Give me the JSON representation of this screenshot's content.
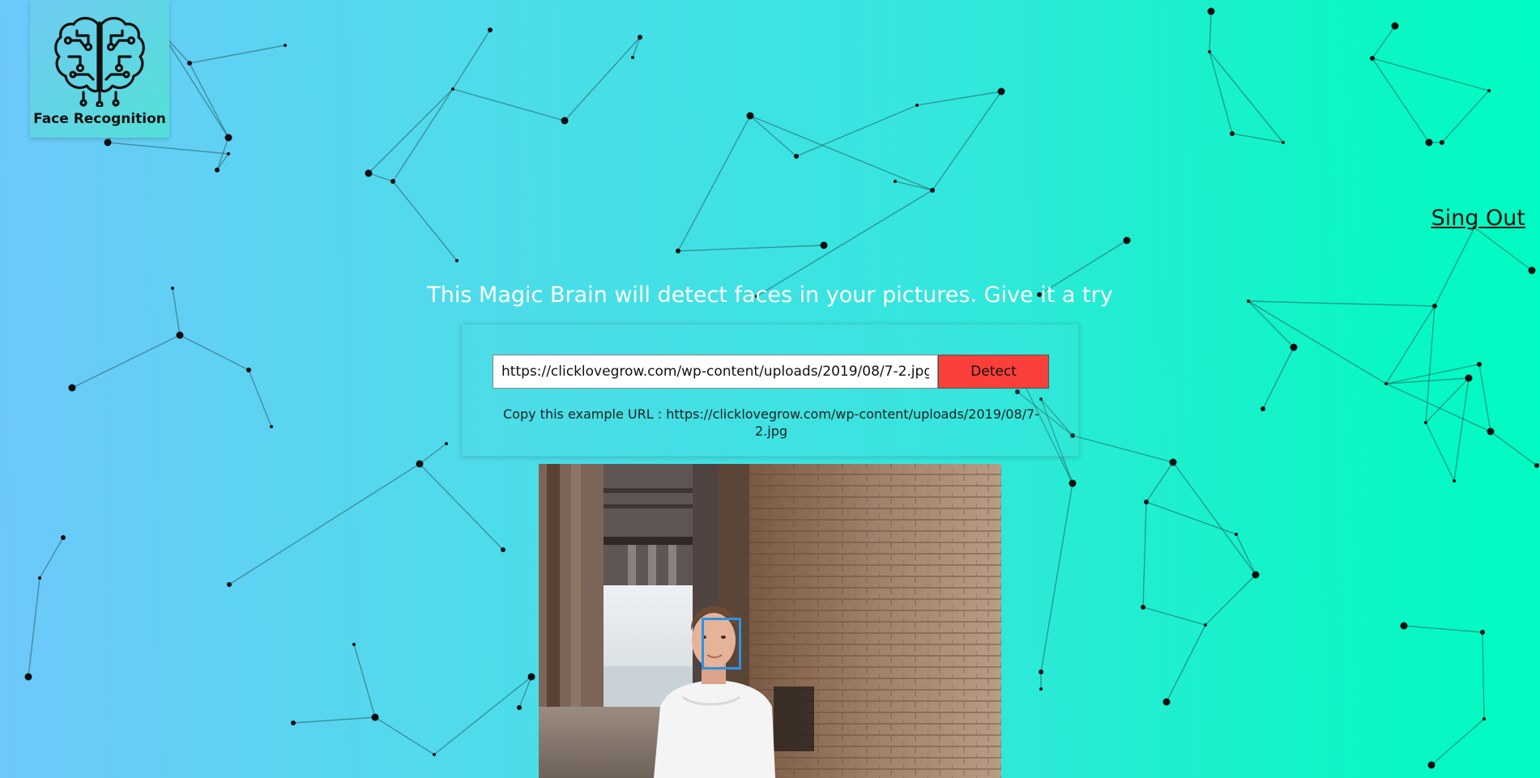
{
  "logo": {
    "caption": "Face Recognition",
    "icon": "brain-circuit-icon"
  },
  "nav": {
    "signout_label": "Sing Out"
  },
  "main": {
    "tagline": "This Magic Brain will detect faces in your pictures. Give it a try",
    "url_input_value": "https://clicklovegrow.com/wp-content/uploads/2019/08/7-2.jpg",
    "detect_label": "Detect",
    "example_text": "Copy this example URL : https://clicklovegrow.com/wp-content/uploads/2019/08/7-2.jpg"
  },
  "result": {
    "image_description_icon": "photo-icon",
    "face_box_color": "#2c93e6"
  },
  "colors": {
    "gradient_start": "#6ec8fb",
    "gradient_end": "#00fbc2",
    "detect_button": "#fb3f3a",
    "text_white": "#ffffff"
  }
}
